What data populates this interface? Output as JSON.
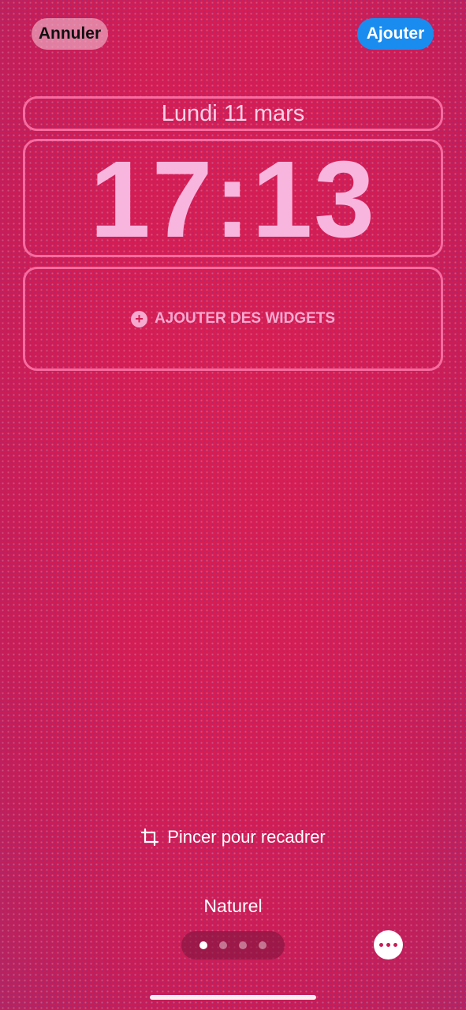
{
  "header": {
    "cancel_label": "Annuler",
    "add_label": "Ajouter"
  },
  "lock_screen": {
    "date": "Lundi 11 mars",
    "time": "17:13",
    "widgets_label": "AJOUTER DES WIDGETS"
  },
  "footer": {
    "crop_hint": "Pincer pour recadrer",
    "filter_name": "Naturel",
    "page_count": 4,
    "active_page": 1
  },
  "colors": {
    "background": "#d41d54",
    "accent_blue": "#1a8cf0",
    "frame_pink": "#ff78aa",
    "time_pink": "#f8b6de"
  },
  "icons": [
    "plus-circle-icon",
    "crop-icon",
    "more-icon"
  ]
}
